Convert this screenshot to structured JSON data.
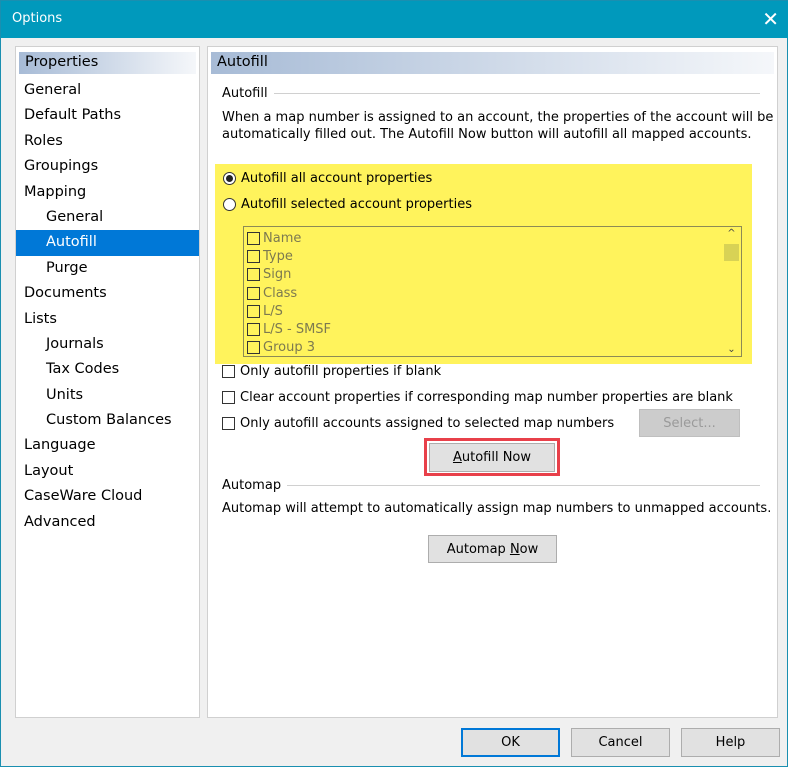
{
  "window": {
    "title": "Options",
    "close": "✕"
  },
  "sidebar": {
    "header": "Properties",
    "items": [
      {
        "label": "General",
        "level": 0
      },
      {
        "label": "Default Paths",
        "level": 0
      },
      {
        "label": "Roles",
        "level": 0
      },
      {
        "label": "Groupings",
        "level": 0
      },
      {
        "label": "Mapping",
        "level": 0
      },
      {
        "label": "General",
        "level": 1
      },
      {
        "label": "Autofill",
        "level": 1,
        "selected": true
      },
      {
        "label": "Purge",
        "level": 1
      },
      {
        "label": "Documents",
        "level": 0
      },
      {
        "label": "Lists",
        "level": 0
      },
      {
        "label": "Journals",
        "level": 1
      },
      {
        "label": "Tax Codes",
        "level": 1
      },
      {
        "label": "Units",
        "level": 1
      },
      {
        "label": "Custom Balances",
        "level": 1
      },
      {
        "label": "Language",
        "level": 0
      },
      {
        "label": "Layout",
        "level": 0
      },
      {
        "label": "CaseWare Cloud",
        "level": 0
      },
      {
        "label": "Advanced",
        "level": 0
      }
    ]
  },
  "main": {
    "header": "Autofill",
    "autofill": {
      "group": "Autofill",
      "description_1": "When a map number is assigned to an account, the properties of the account will be",
      "description_2": "automatically filled out. The Autofill Now button will autofill all mapped accounts.",
      "radio_all": "Autofill all account properties",
      "radio_selected": "Autofill selected account properties",
      "properties": [
        "Name",
        "Type",
        "Sign",
        "Class",
        "L/S",
        "L/S - SMSF",
        "Group 3"
      ],
      "check_blank": "Only autofill properties if blank",
      "check_clear": "Clear account properties if corresponding map number properties are blank",
      "check_selected": "Only autofill accounts assigned to selected map numbers",
      "select_button": "Select...",
      "autofill_now_prefix": "A",
      "autofill_now_rest": "utofill Now"
    },
    "automap": {
      "group": "Automap",
      "description": "Automap will attempt to automatically assign map numbers to unmapped accounts.",
      "button_prefix": "Automap ",
      "button_ul": "N",
      "button_rest": "ow"
    }
  },
  "footer": {
    "ok": "OK",
    "cancel": "Cancel",
    "help": "Help"
  },
  "colors": {
    "titlebar": "#0099bc",
    "highlight": "#fff35c",
    "selected": "#0078d7",
    "callout": "#e8404a"
  }
}
